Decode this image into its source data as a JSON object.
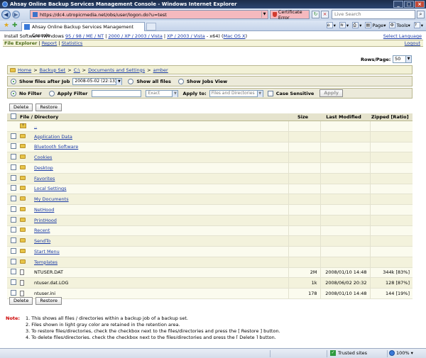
{
  "window": {
    "title": "Ahsay Online Backup Services Management Console - Windows Internet Explorer",
    "address": "https://dc4.utropicmedia.net/obs/user/logon.do?u=test",
    "cert_error": "Certificate Error",
    "search_placeholder": "Live Search",
    "tab_title": "Ahsay Online Backup Services Management Console",
    "toolbar": {
      "page": "Page",
      "tools": "Tools"
    }
  },
  "install": {
    "prefix": "Install Software (Windows",
    "link1": "95 / 98 / ME / NT",
    "link2": "2000 / XP / 2003 / Vista",
    "link3": "XP / 2003 / Vista",
    "suffix": "- x64)",
    "link4": "Mac OS X",
    "select_language": "Select Language"
  },
  "nav": {
    "file_explorer": "File Explorer",
    "report": "Report",
    "statistics": "Statistics",
    "logout": "Logout"
  },
  "rows_per_page": {
    "label": "Rows/Page:",
    "value": "50"
  },
  "breadcrumb": [
    "Home",
    "Backup Set",
    "C:\\",
    "Documents and Settings",
    "amber"
  ],
  "options": {
    "show_after_job": "Show files after Job",
    "job_value": "2008-05-02 (22:13)",
    "show_all": "Show all files",
    "show_jobs_view": "Show Jobs View",
    "no_filter": "No Filter",
    "apply_filter": "Apply Filter",
    "match_type": "Exact",
    "apply_to": "Apply to:",
    "apply_to_value": "Files and Directories",
    "case_sensitive": "Case Sensitive",
    "apply_button": "Apply"
  },
  "actions": {
    "delete": "Delete",
    "restore": "Restore"
  },
  "table": {
    "headers": {
      "name": "File / Directory",
      "size": "Size",
      "modified": "Last Modified",
      "zipped": "Zipped [Ratio]"
    },
    "up": "..",
    "folders": [
      "Application Data",
      "Bluetooth Software",
      "Cookies",
      "Desktop",
      "Favorites",
      "Local Settings",
      "My Documents",
      "NetHood",
      "PrintHood",
      "Recent",
      "SendTo",
      "Start Menu",
      "Templates"
    ],
    "files": [
      {
        "name": "NTUSER.DAT",
        "size": "2M",
        "modified": "2008/01/10 14:48",
        "zipped": "344k [83%]"
      },
      {
        "name": "ntuser.dat.LOG",
        "size": "1k",
        "modified": "2008/06/02 20:32",
        "zipped": "128 [87%]"
      },
      {
        "name": "ntuser.ini",
        "size": "178",
        "modified": "2008/01/10 14:48",
        "zipped": "144 [19%]"
      }
    ]
  },
  "notes": {
    "label": "Note:",
    "items": [
      "1.    This shows all files / directories within a backup job of a backup set.",
      "2.    Files shown in light gray color are retained in the retention area.",
      "3.    To restore files/directories, check the checkbox next to the files/directories and press the [ Restore ] button.",
      "4.    To delete files/directories, check the checkbox next to the files/directories and press the [ Delete ] button."
    ]
  },
  "status": {
    "trusted": "Trusted sites",
    "zoom": "100%"
  }
}
